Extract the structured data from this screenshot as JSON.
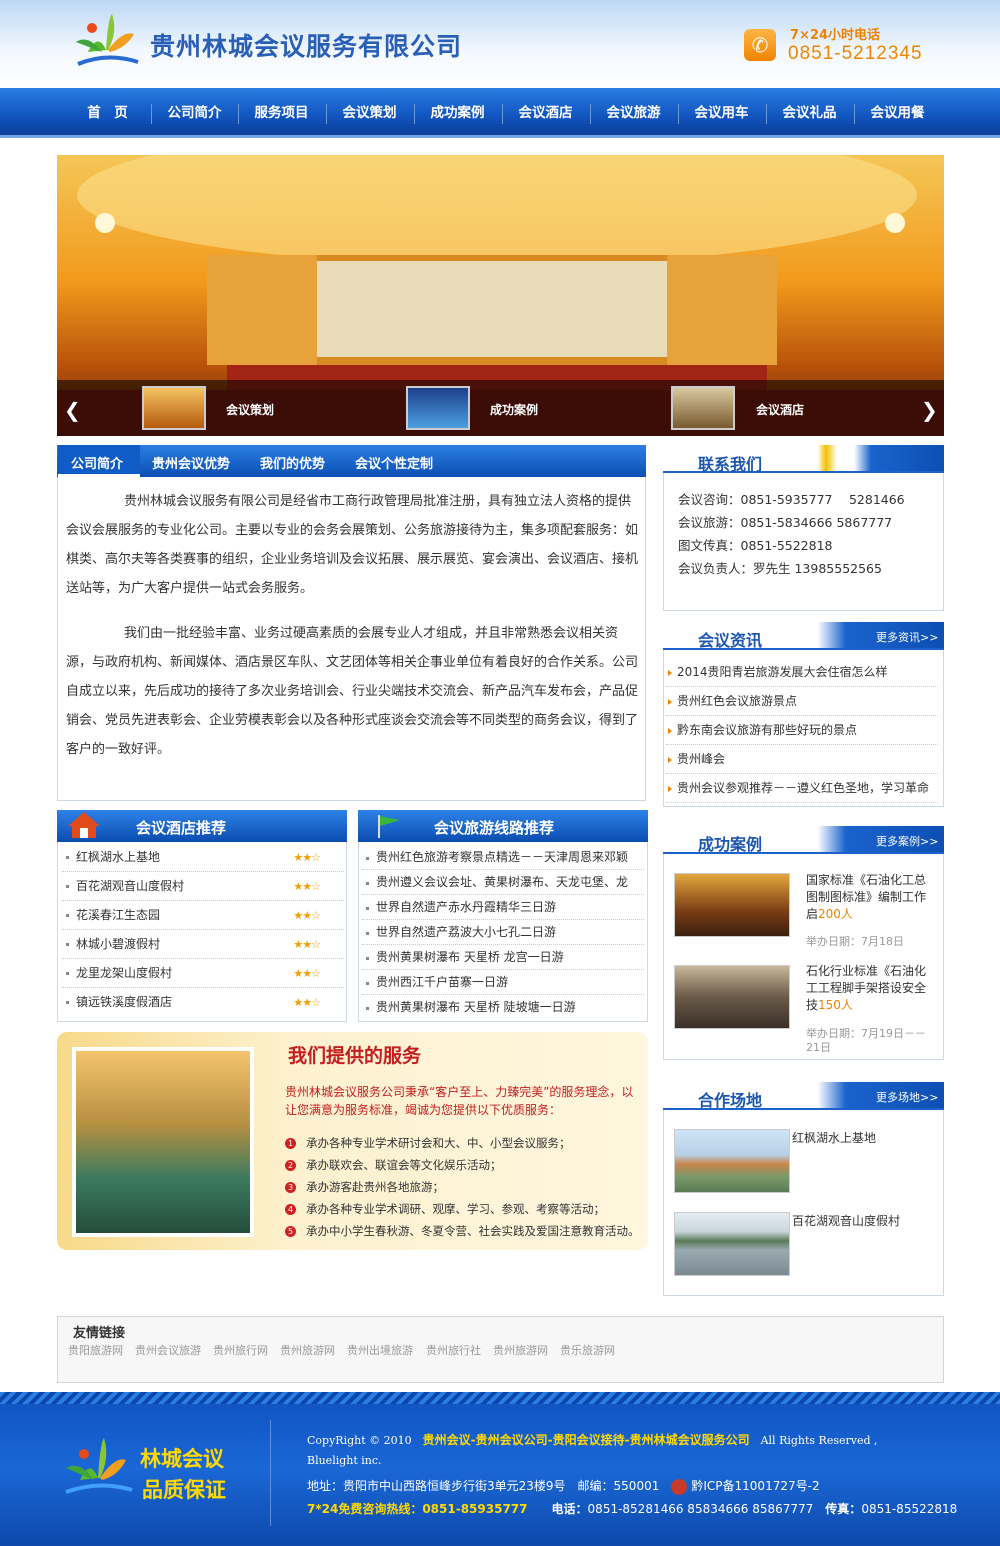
{
  "header": {
    "company_name": "贵州林城会议服务有限公司",
    "hotline_label": "7×24小时电话",
    "hotline_number": "0851-5212345"
  },
  "nav": {
    "items": [
      "首　页",
      "公司简介",
      "服务项目",
      "会议策划",
      "成功案例",
      "会议酒店",
      "会议旅游",
      "会议用车",
      "会议礼品",
      "会议用餐"
    ]
  },
  "banner": {
    "thumbs": [
      "会议策划",
      "成功案例",
      "会议酒店"
    ]
  },
  "about": {
    "tabs": [
      "公司简介",
      "贵州会议优势",
      "我们的优势",
      "会议个性定制"
    ],
    "paragraphs": [
      "贵州林城会议服务有限公司是经省市工商行政管理局批准注册，具有独立法人资格的提供会议会展服务的专业化公司。主要以专业的会务会展策划、公务旅游接待为主，集多项配套服务：如棋类、高尔夫等各类赛事的组织，企业业务培训及会议拓展、展示展览、宴会演出、会议酒店、接机送站等，为广大客户提供一站式会务服务。",
      "我们由一批经验丰富、业务过硬高素质的会展专业人才组成，并且非常熟悉会议相关资源，与政府机构、新闻媒体、酒店景区车队、文艺团体等相关企事业单位有着良好的合作关系。公司自成立以来，先后成功的接待了多次业务培训会、行业尖端技术交流会、新产品汽车发布会，产品促销会、党员先进表彰会、企业劳模表彰会以及各种形式座谈会交流会等不同类型的商务会议，得到了客户的一致好评。"
    ]
  },
  "contact": {
    "title": "联系我们",
    "lines": [
      "会议咨询：0851-5935777　 5281466",
      "会议旅游：0851-5834666 5867777",
      "图文传真：0851-5522818",
      "会议负责人：罗先生 13985552565"
    ]
  },
  "news": {
    "title": "会议资讯",
    "more": "更多资讯>>",
    "items": [
      "2014贵阳青岩旅游发展大会住宿怎么样",
      "贵州红色会议旅游景点",
      "黔东南会议旅游有那些好玩的景点",
      "贵州峰会",
      "贵州会议参观推荐－－遵义红色圣地，学习革命"
    ]
  },
  "cases": {
    "title": "成功案例",
    "more": "更多案例>>",
    "items": [
      {
        "title": "国家标准《石油化工总图制图标准》编制工作启",
        "count": "200人",
        "date": "举办日期：7月18日"
      },
      {
        "title": "石化行业标准《石油化工工程脚手架搭设安全技",
        "count": "150人",
        "date": "举办日期：7月19日－－21日"
      }
    ]
  },
  "sites": {
    "title": "合作场地",
    "more": "更多场地>>",
    "items": [
      "红枫湖水上基地",
      "百花湖观音山度假村"
    ]
  },
  "hotels": {
    "title": "会议酒店推荐",
    "items": [
      "红枫湖水上基地",
      "百花湖观音山度假村",
      "花溪春江生态园",
      "林城小碧渡假村",
      "龙里龙架山度假村",
      "镇远铁溪度假酒店"
    ],
    "stars": "★★☆"
  },
  "routes": {
    "title": "会议旅游线路推荐",
    "items": [
      "贵州红色旅游考察景点精选－－天津周恩来邓颖",
      "贵州遵义会议会址、黄果树瀑布、天龙屯堡、龙",
      "世界自然遗产赤水丹霞精华三日游",
      "世界自然遗产荔波大小七孔二日游",
      "贵州黄果树瀑布 天星桥 龙宫一日游",
      "贵州西江千户苗寨一日游",
      "贵州黄果树瀑布 天星桥 陡坡塘一日游"
    ]
  },
  "services": {
    "heading": "我们提供的服务",
    "intro": "贵州林城会议服务公司秉承“客户至上、力臻完美”的服务理念，以让您满意为服务标准，竭诚为您提供以下优质服务：",
    "items": [
      "承办各种专业学术研讨会和大、中、小型会议服务；",
      "承办联欢会、联谊会等文化娱乐活动；",
      "承办游客赴贵州各地旅游；",
      "承办各种专业学术调研、观摩、学习、参观、考察等活动；",
      "承办中小学生春秋游、冬夏令营、社会实践及爱国注意教育活动。"
    ]
  },
  "links": {
    "title": "友情链接",
    "items": [
      "贵阳旅游网",
      "贵州会议旅游",
      "贵州旅行网",
      "贵州旅游网",
      "贵州出境旅游",
      "贵州旅行社",
      "贵州旅游网",
      "贵乐旅游网"
    ]
  },
  "footer": {
    "slogan1": "林城会议",
    "slogan2": "品质保证",
    "copyright_prefix": "CopyRight © 2010",
    "copyright_links": "贵州会议-贵州会议公司-贵阳会议接待-贵州林城会议服务公司",
    "copyright_suffix": "All Rights Reserved ,",
    "copyright_line2": "Bluelight inc.",
    "address": "地址：贵阳市中山西路恒峰步行街3单元23楼9号　邮编：550001",
    "icp": "黔ICP备11001727号-2",
    "hotline": "7*24免费咨询热线：0851-85935777",
    "phone_label": "电话：",
    "phone": "0851-85281466 85834666 85867777",
    "fax_label": "传真：",
    "fax": "0851-85522818"
  },
  "colors": {
    "brand_blue": "#1155bf",
    "accent_orange": "#f08400",
    "service_red": "#c41e1e"
  }
}
